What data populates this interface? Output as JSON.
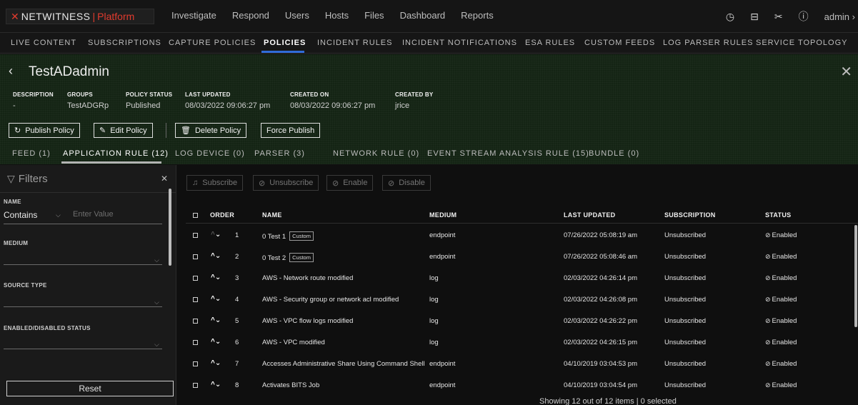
{
  "brand": {
    "name": "NETWITNESS",
    "sep": "|",
    "product": "Platform"
  },
  "topnav": [
    "Investigate",
    "Respond",
    "Users",
    "Hosts",
    "Files",
    "Dashboard",
    "Reports"
  ],
  "user": {
    "name": "admin",
    "caret": "›"
  },
  "subnav": [
    "LIVE CONTENT",
    "SUBSCRIPTIONS",
    "CAPTURE POLICIES",
    "POLICIES",
    "INCIDENT RULES",
    "INCIDENT NOTIFICATIONS",
    "ESA RULES",
    "CUSTOM FEEDS",
    "LOG PARSER RULES",
    "SERVICE TOPOLOGY"
  ],
  "policy": {
    "title": "TestADadmin",
    "meta": [
      {
        "label": "DESCRIPTION",
        "value": "-"
      },
      {
        "label": "GROUPS",
        "value": "TestADGRp"
      },
      {
        "label": "POLICY STATUS",
        "value": "Published"
      },
      {
        "label": "LAST UPDATED",
        "value": "08/03/2022 09:06:27 pm"
      },
      {
        "label": "CREATED ON",
        "value": "08/03/2022 09:06:27 pm"
      },
      {
        "label": "CREATED BY",
        "value": "jrice"
      }
    ],
    "buttons": {
      "publish": "Publish Policy",
      "edit": "Edit Policy",
      "delete": "Delete Policy",
      "force": "Force Publish"
    },
    "tabs": [
      "FEED (1)",
      "APPLICATION RULE (12)",
      "LOG DEVICE (0)",
      "PARSER (3)",
      "NETWORK RULE (0)",
      "EVENT STREAM ANALYSIS RULE (15)",
      "BUNDLE (0)"
    ]
  },
  "filters": {
    "title": "Filters",
    "name_label": "NAME",
    "operator": "Contains",
    "value_placeholder": "Enter Value",
    "medium_label": "MEDIUM",
    "source_type_label": "SOURCE TYPE",
    "status_label": "ENABLED/DISABLED STATUS",
    "reset": "Reset"
  },
  "actions": {
    "subscribe": "Subscribe",
    "unsubscribe": "Unsubscribe",
    "enable": "Enable",
    "disable": "Disable"
  },
  "table": {
    "columns": [
      "ORDER",
      "NAME",
      "MEDIUM",
      "LAST UPDATED",
      "SUBSCRIPTION",
      "STATUS"
    ],
    "rows": [
      {
        "order": "1",
        "name": "0 Test 1",
        "badge": "Custom",
        "medium": "endpoint",
        "updated": "07/26/2022 05:08:19 am",
        "subscription": "Unsubscribed",
        "status": "Enabled"
      },
      {
        "order": "2",
        "name": "0 Test 2",
        "badge": "Custom",
        "medium": "endpoint",
        "updated": "07/26/2022 05:08:46 am",
        "subscription": "Unsubscribed",
        "status": "Enabled"
      },
      {
        "order": "3",
        "name": "AWS - Network route modified",
        "badge": "",
        "medium": "log",
        "updated": "02/03/2022 04:26:14 pm",
        "subscription": "Unsubscribed",
        "status": "Enabled"
      },
      {
        "order": "4",
        "name": "AWS - Security group or network acl modified",
        "badge": "",
        "medium": "log",
        "updated": "02/03/2022 04:26:08 pm",
        "subscription": "Unsubscribed",
        "status": "Enabled"
      },
      {
        "order": "5",
        "name": "AWS - VPC flow logs modified",
        "badge": "",
        "medium": "log",
        "updated": "02/03/2022 04:26:22 pm",
        "subscription": "Unsubscribed",
        "status": "Enabled"
      },
      {
        "order": "6",
        "name": "AWS - VPC modified",
        "badge": "",
        "medium": "log",
        "updated": "02/03/2022 04:26:15 pm",
        "subscription": "Unsubscribed",
        "status": "Enabled"
      },
      {
        "order": "7",
        "name": "Accesses Administrative Share Using Command Shell",
        "badge": "",
        "medium": "endpoint",
        "updated": "04/10/2019 03:04:53 pm",
        "subscription": "Unsubscribed",
        "status": "Enabled"
      },
      {
        "order": "8",
        "name": "Activates BITS Job",
        "badge": "",
        "medium": "endpoint",
        "updated": "04/10/2019 03:04:54 pm",
        "subscription": "Unsubscribed",
        "status": "Enabled"
      }
    ],
    "footer": "Showing 12 out of 12 items | 0 selected"
  },
  "icons": {
    "back": "back-arrow-icon",
    "close": "close-icon",
    "filter": "filter-icon",
    "timer": "timer-icon",
    "settings": "settings-icon",
    "tools": "tools-icon",
    "help": "help-icon"
  },
  "colors": {
    "accent": "#e23b2e",
    "tab_underline": "#2f6bd8",
    "header_bg": "#142414"
  }
}
